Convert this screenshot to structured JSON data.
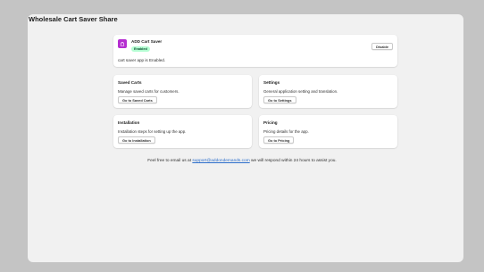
{
  "page": {
    "title": "Wholesale Cart Saver Share"
  },
  "app_card": {
    "icon": "app-bag-icon",
    "name": "ADD Cart Saver",
    "badge": "Enabled",
    "status": "cart saver app is Enabled.",
    "disable_label": "Disable"
  },
  "sections": {
    "saved_carts": {
      "title": "Saved Carts",
      "description": "Manage saved carts for customers.",
      "button": "Go to Saved Carts"
    },
    "settings": {
      "title": "Settings",
      "description": "General application setting and translation.",
      "button": "Go to Settings"
    },
    "installation": {
      "title": "Installation",
      "description": "Installation steps for setting up the app.",
      "button": "Go to Installation"
    },
    "pricing": {
      "title": "Pricing",
      "description": "Pricing details for the app.",
      "button": "Go to Pricing"
    }
  },
  "footer": {
    "prefix": "Feel free to email us at ",
    "email": "support@addondemands.com",
    "suffix": " we will respond within 24 hours to assist you."
  },
  "colors": {
    "app_icon": "#b52ed0",
    "badge_bg": "#b4fed2",
    "badge_text": "#0c5132",
    "link": "#2c6ecb"
  }
}
